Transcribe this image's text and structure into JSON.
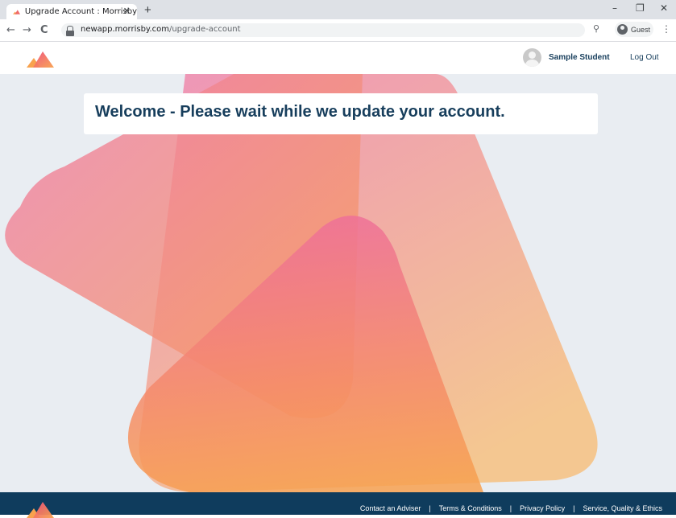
{
  "browser": {
    "tab_title": "Upgrade Account : Morrisby",
    "tab_close": "✕",
    "new_tab": "+",
    "url_domain": "newapp.morrisby.com",
    "url_path": "/upgrade-account",
    "guest_label": "Guest",
    "back": "←",
    "forward": "→",
    "reload": "C",
    "zoom": "⚲",
    "menu": "⋮",
    "minimize": "–",
    "restore": "❐",
    "close": "✕"
  },
  "header": {
    "user_name": "Sample Student",
    "logout_label": "Log Out"
  },
  "main": {
    "welcome_message": "Welcome - Please wait while we update your account."
  },
  "footer": {
    "links": [
      "Contact an Adviser",
      "Terms & Conditions",
      "Privacy Policy",
      "Service, Quality & Ethics"
    ],
    "separator": "|"
  },
  "colors": {
    "brand_navy": "#173e5c",
    "footer_bg": "#0f3c5d",
    "page_bg": "#e9edf2",
    "gradient_pink": "#ef7ba6",
    "gradient_orange": "#f8a24e"
  }
}
